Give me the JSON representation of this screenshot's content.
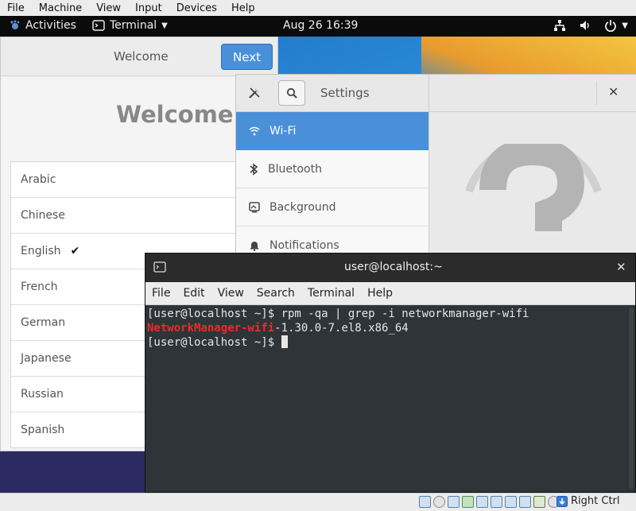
{
  "vm_menubar": [
    "File",
    "Machine",
    "View",
    "Input",
    "Devices",
    "Help"
  ],
  "topbar": {
    "activities": "Activities",
    "app_menu": "Terminal",
    "clock": "Aug 26  16:39"
  },
  "welcome": {
    "title": "Welcome",
    "next_button": "Next",
    "heading": "Welcome!",
    "languages": [
      "Arabic",
      "Chinese",
      "English",
      "French",
      "German",
      "Japanese",
      "Russian",
      "Spanish"
    ],
    "selected_language": "English",
    "check": "✔"
  },
  "settings": {
    "title": "Settings",
    "close": "✕",
    "items": [
      {
        "label": "Wi-Fi",
        "icon": "wifi-icon"
      },
      {
        "label": "Bluetooth",
        "icon": "bluetooth-icon"
      },
      {
        "label": "Background",
        "icon": "background-icon"
      },
      {
        "label": "Notifications",
        "icon": "bell-icon"
      }
    ],
    "selected": "Wi-Fi"
  },
  "terminal": {
    "title": "user@localhost:~",
    "close": "✕",
    "menu": [
      "File",
      "Edit",
      "View",
      "Search",
      "Terminal",
      "Help"
    ],
    "line1": "[user@localhost ~]$ rpm -qa | grep -i networkmanager-wifi",
    "line2_match": "NetworkManager-wifi",
    "line2_rest": "-1.30.0-7.el8.x86_64",
    "line3": "[user@localhost ~]$ "
  },
  "statusbar": {
    "host_key": "Right Ctrl"
  }
}
